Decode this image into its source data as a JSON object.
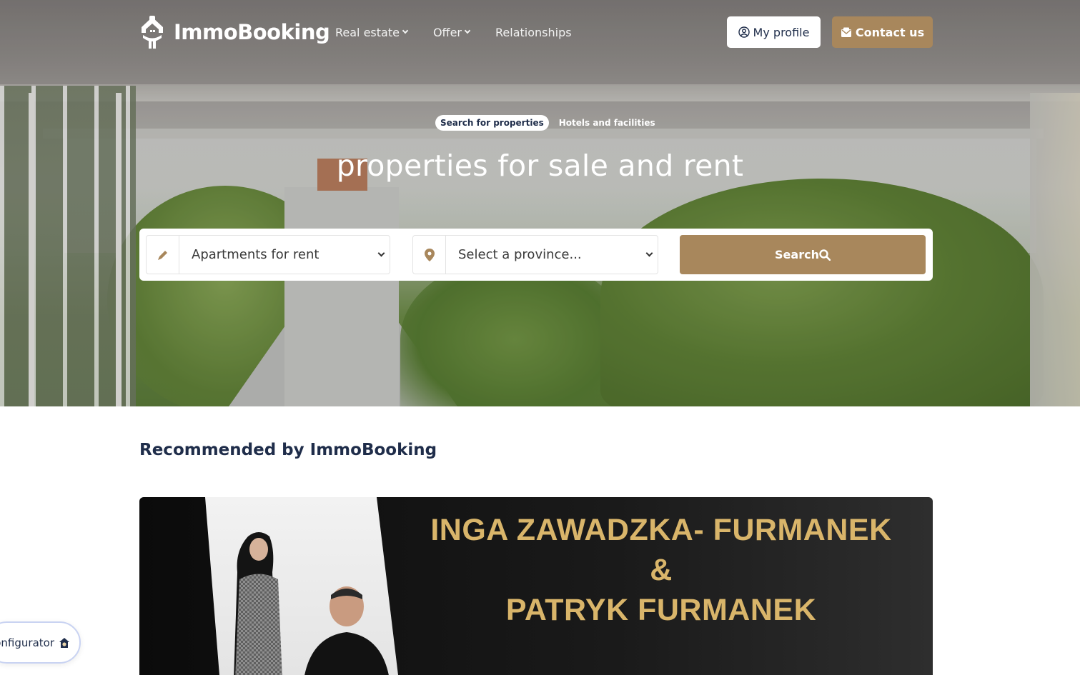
{
  "brand": {
    "name": "ImmoBooking",
    "accent_color": "#a8875c",
    "text_color": "#1f2d4a"
  },
  "nav": {
    "items": [
      {
        "label": "Real estate",
        "has_dropdown": true
      },
      {
        "label": "Offer",
        "has_dropdown": true
      },
      {
        "label": "Relationships",
        "has_dropdown": false
      }
    ],
    "profile_label": "My profile",
    "contact_label": "Contact us"
  },
  "hero": {
    "tabs": [
      {
        "label": "Search for properties",
        "active": true
      },
      {
        "label": "Hotels and facilities",
        "active": false
      }
    ],
    "title": "properties for sale and rent"
  },
  "search": {
    "type_value": "Apartments for rent",
    "province_value": "Select a province...",
    "button_label": "Search",
    "icons": {
      "type": "pencil-icon",
      "province": "map-pin-icon",
      "button": "search-icon"
    }
  },
  "recommended": {
    "title": "Recommended by ImmoBooking",
    "banner": {
      "line1": "INGA ZAWADZKA- FURMANEK",
      "line2": "&",
      "line3": "PATRYK FURMANEK",
      "text_color": "#d9b56a"
    }
  },
  "configurator": {
    "label": "onfigurator"
  }
}
